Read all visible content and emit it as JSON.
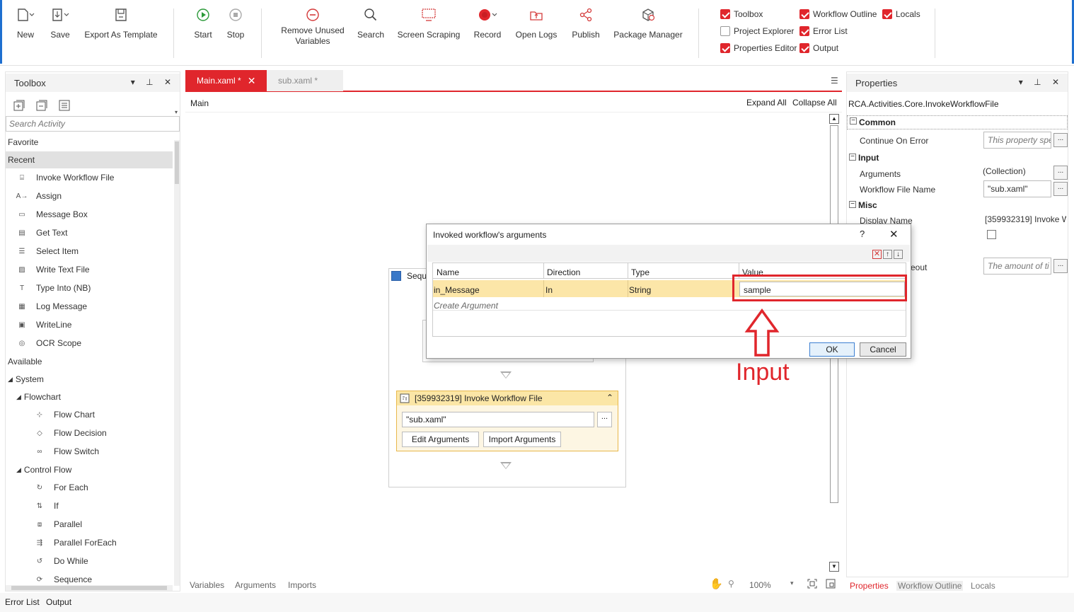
{
  "ribbon": {
    "new": "New",
    "save": "Save",
    "export_template": "Export As Template",
    "start": "Start",
    "stop": "Stop",
    "remove_unused_1": "Remove Unused",
    "remove_unused_2": "Variables",
    "search": "Search",
    "screen_scraping": "Screen Scraping",
    "record": "Record",
    "open_logs": "Open Logs",
    "publish": "Publish",
    "package_manager": "Package Manager",
    "checks": {
      "toolbox": "Toolbox",
      "project_explorer": "Project Explorer",
      "properties_editor": "Properties Editor",
      "workflow_outline": "Workflow Outline",
      "error_list": "Error List",
      "output": "Output",
      "locals": "Locals"
    },
    "accent_color": "#1e6fd0"
  },
  "toolbox": {
    "title": "Toolbox",
    "search_placeholder": "Search Activity",
    "favorite": "Favorite",
    "recent": "Recent",
    "recent_items": [
      "Invoke Workflow File",
      "Assign",
      "Message Box",
      "Get Text",
      "Select Item",
      "Write Text File",
      "Type Into (NB)",
      "Log Message",
      "WriteLine",
      "OCR Scope"
    ],
    "available": "Available",
    "system": "System",
    "flowchart": "Flowchart",
    "flowchart_items": [
      "Flow Chart",
      "Flow Decision",
      "Flow Switch"
    ],
    "control_flow": "Control Flow",
    "control_flow_items": [
      "For Each",
      "If",
      "Parallel",
      "Parallel ForEach",
      "Do While",
      "Sequence"
    ]
  },
  "tabs": {
    "main": "Main.xaml *",
    "sub": "sub.xaml *",
    "active_color": "#e0262c"
  },
  "designer": {
    "breadcrumb": "Main",
    "expand_all": "Expand All",
    "collapse_all": "Collapse All",
    "sequence_label": "Sequ",
    "invoke_title": "[359932319] Invoke Workflow File",
    "invoke_file": "\"sub.xaml\"",
    "edit_arguments": "Edit Arguments",
    "import_arguments": "Import Arguments",
    "bottom_tabs": [
      "Variables",
      "Arguments",
      "Imports"
    ],
    "zoom": "100%"
  },
  "properties": {
    "title": "Properties",
    "type": "RCA.Activities.Core.InvokeWorkflowFile",
    "common": "Common",
    "continue_on_error": "Continue On Error",
    "continue_on_error_placeholder": "This property spe",
    "input": "Input",
    "arguments": "Arguments",
    "arguments_value": "(Collection)",
    "workflow_file_name": "Workflow File Name",
    "workflow_file_value": "\"sub.xaml\"",
    "misc": "Misc",
    "display_name": "Display Name",
    "display_name_value": "[359932319] Invoke W",
    "timeout_partial": "eout",
    "timeout_placeholder": "The amount of ti",
    "bottom_tabs": [
      "Properties",
      "Workflow Outline",
      "Locals"
    ]
  },
  "dialog": {
    "title": "Invoked workflow's arguments",
    "help": "?",
    "headers": [
      "Name",
      "Direction",
      "Type",
      "Value"
    ],
    "row": {
      "name": "in_Message",
      "direction": "In",
      "type": "String",
      "value": "sample"
    },
    "create_argument": "Create Argument",
    "ok": "OK",
    "cancel": "Cancel"
  },
  "annotation": {
    "text": "Input",
    "color": "#e0262c"
  },
  "bottom_bar": {
    "error_list": "Error List",
    "output": "Output"
  }
}
